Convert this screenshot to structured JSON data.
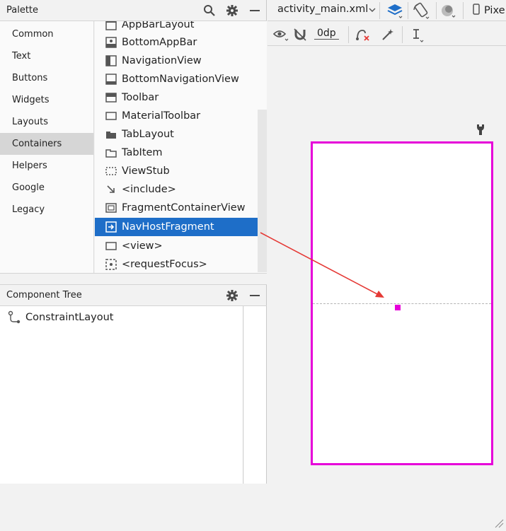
{
  "palette": {
    "title": "Palette",
    "categories": [
      "Common",
      "Text",
      "Buttons",
      "Widgets",
      "Layouts",
      "Containers",
      "Helpers",
      "Google",
      "Legacy"
    ],
    "selected_category": "Containers",
    "items": [
      {
        "label": "AppBarLayout",
        "icon": "appbar-icon"
      },
      {
        "label": "BottomAppBar",
        "icon": "bottom-appbar-icon"
      },
      {
        "label": "NavigationView",
        "icon": "navigation-view-icon"
      },
      {
        "label": "BottomNavigationView",
        "icon": "bottom-navigation-icon"
      },
      {
        "label": "Toolbar",
        "icon": "toolbar-icon"
      },
      {
        "label": "MaterialToolbar",
        "icon": "material-toolbar-icon"
      },
      {
        "label": "TabLayout",
        "icon": "tab-layout-icon"
      },
      {
        "label": "TabItem",
        "icon": "tab-item-icon"
      },
      {
        "label": "ViewStub",
        "icon": "viewstub-icon"
      },
      {
        "label": "<include>",
        "icon": "include-arrow-icon"
      },
      {
        "label": "FragmentContainerView",
        "icon": "fragment-container-icon"
      },
      {
        "label": "NavHostFragment",
        "icon": "nav-host-icon"
      },
      {
        "label": "<view>",
        "icon": "view-icon"
      },
      {
        "label": "<requestFocus>",
        "icon": "request-focus-icon"
      }
    ],
    "selected_item": "NavHostFragment"
  },
  "component_tree": {
    "title": "Component Tree",
    "root": "ConstraintLayout"
  },
  "editor": {
    "file_tab": "activity_main.xml",
    "device_label": "Pixe",
    "default_margin": "0dp"
  },
  "colors": {
    "selection": "#1e6ec8",
    "blueprint_border": "#e600d9",
    "drag_arrow": "#e53935"
  }
}
